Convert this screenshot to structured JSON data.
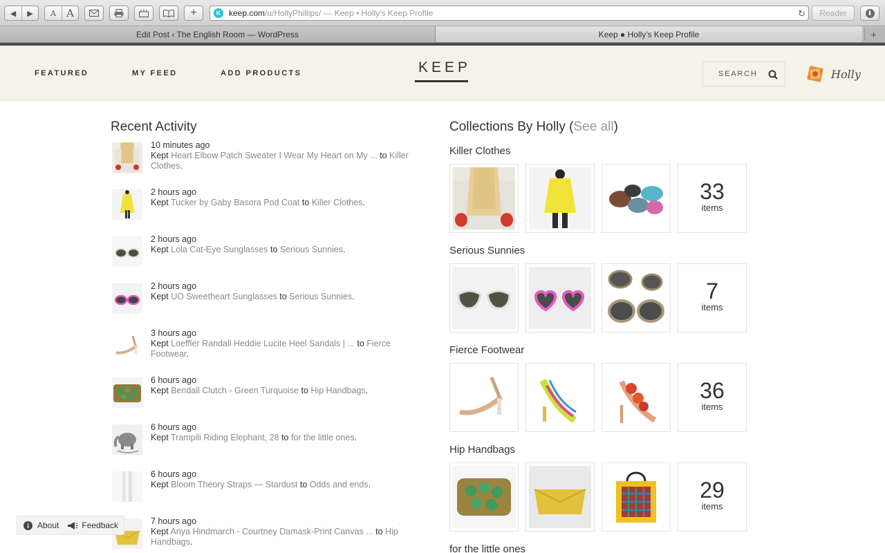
{
  "browser": {
    "url_host": "keep.com",
    "url_path": "/u/HollyPhillips/",
    "url_title": "— Keep • Holly's Keep Profile",
    "reader_label": "Reader",
    "tabs": [
      {
        "label": "Edit Post ‹ The English Room — WordPress"
      },
      {
        "label": "Keep ● Holly's Keep Profile"
      }
    ]
  },
  "header": {
    "nav": {
      "featured": "FEATURED",
      "my_feed": "MY FEED",
      "add_products": "ADD PRODUCTS"
    },
    "logo": "KEEP",
    "search_label": "SEARCH",
    "username": "Holly"
  },
  "activity": {
    "title": "Recent Activity",
    "items": [
      {
        "time": "10 minutes ago",
        "verb": "Kept",
        "product": "Heart Elbow Patch Sweater I Wear My Heart on My ...",
        "connector": "to",
        "collection": "Killer Clothes",
        "end": "."
      },
      {
        "time": "2 hours ago",
        "verb": "Kept",
        "product": "Tucker by Gaby Basora Pod Coat",
        "connector": "to",
        "collection": "Killer Clothes",
        "end": "."
      },
      {
        "time": "2 hours ago",
        "verb": "Kept",
        "product": "Lola Cat-Eye Sunglasses",
        "connector": "to",
        "collection": "Serious Sunnies",
        "end": "."
      },
      {
        "time": "2 hours ago",
        "verb": "Kept",
        "product": "UO Sweetheart Sunglasses",
        "connector": "to",
        "collection": "Serious Sunnies",
        "end": "."
      },
      {
        "time": "3 hours ago",
        "verb": "Kept",
        "product": "Loeffler Randall Heddie Lucite Heel Sandals | ...",
        "connector": "to",
        "collection": "Fierce Footwear",
        "end": "."
      },
      {
        "time": "6 hours ago",
        "verb": "Kept",
        "product": "Bendall Clutch - Green Turquoise",
        "connector": "to",
        "collection": "Hip Handbags",
        "end": "."
      },
      {
        "time": "6 hours ago",
        "verb": "Kept",
        "product": "Trampili Riding Elephant, 28",
        "connector": "to",
        "collection": "for the little ones",
        "end": "."
      },
      {
        "time": "6 hours ago",
        "verb": "Kept",
        "product": "Bloom Theory Straps — Stardust",
        "connector": "to",
        "collection": "Odds and ends",
        "end": "."
      },
      {
        "time": "7 hours ago",
        "verb": "Kept",
        "product": "Anya Hindmarch - Courtney Damask-Print Canvas ...",
        "connector": "to",
        "collection": "Hip Handbags",
        "end": "."
      }
    ]
  },
  "collections": {
    "title_prefix": "Collections By Holly (",
    "see_all": "See all",
    "title_suffix": ")",
    "items_label": "items",
    "list": [
      {
        "name": "Killer Clothes",
        "count": "33"
      },
      {
        "name": "Serious Sunnies",
        "count": "7"
      },
      {
        "name": "Fierce Footwear",
        "count": "36"
      },
      {
        "name": "Hip Handbags",
        "count": "29"
      },
      {
        "name": "for the little ones"
      }
    ]
  },
  "footer": {
    "about": "About",
    "feedback": "Feedback"
  }
}
